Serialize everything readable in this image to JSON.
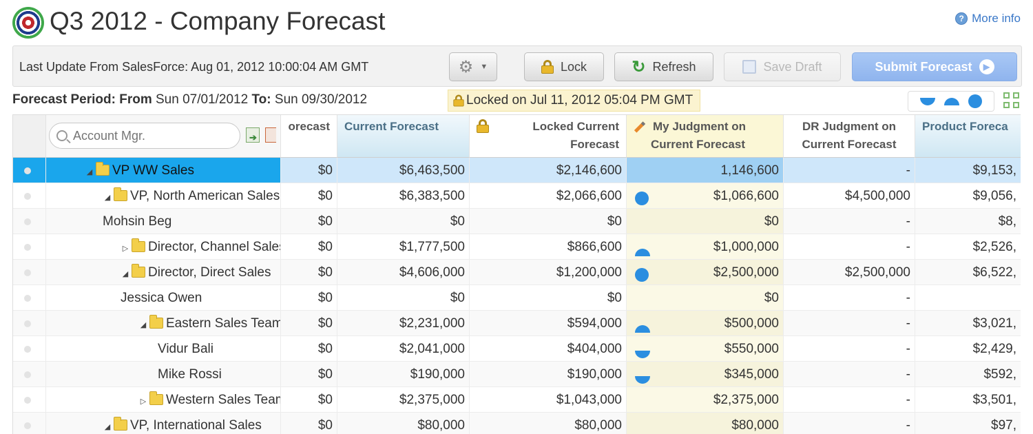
{
  "app": {
    "title": "Q3 2012 - Company Forecast",
    "more_info": "More info"
  },
  "toolbar": {
    "last_update": "Last Update From SalesForce: Aug 01, 2012 10:00:04 AM GMT",
    "lock_label": "Lock",
    "refresh_label": "Refresh",
    "save_draft_label": "Save Draft",
    "submit_label": "Submit Forecast"
  },
  "period": {
    "from_label": "Forecast Period: From",
    "from_value": "Sun 07/01/2012",
    "to_label": "To:",
    "to_value": "Sun 09/30/2012",
    "locked_text": "Locked on Jul 11, 2012 05:04 PM GMT"
  },
  "grid": {
    "search_placeholder": "Account Mgr.",
    "headers": {
      "c1": "orecast",
      "c2": "Current Forecast",
      "c3_line1": "Locked Current",
      "c3_line2": "Forecast",
      "c4_line1": "My Judgment on",
      "c4_line2": "Current Forecast",
      "c5_line1": "DR Judgment on",
      "c5_line2": "Current Forecast",
      "c6": "Product Foreca"
    },
    "rows": [
      {
        "name": "VP WW Sales",
        "c1": "$0",
        "c2": "$6,463,500",
        "c3": "$2,146,600",
        "c4": "1,146,600",
        "c5": "-",
        "c6": "$9,153,"
      },
      {
        "name": "VP, North American Sales",
        "c1": "$0",
        "c2": "$6,383,500",
        "c3": "$2,066,600",
        "c4": "$1,066,600",
        "c5": "$4,500,000",
        "c6": "$9,056,"
      },
      {
        "name": "Mohsin Beg",
        "c1": "$0",
        "c2": "$0",
        "c3": "$0",
        "c4": "$0",
        "c5": "-",
        "c6": "$8,"
      },
      {
        "name": "Director, Channel Sales",
        "c1": "$0",
        "c2": "$1,777,500",
        "c3": "$866,600",
        "c4": "$1,000,000",
        "c5": "-",
        "c6": "$2,526,"
      },
      {
        "name": "Director, Direct Sales",
        "c1": "$0",
        "c2": "$4,606,000",
        "c3": "$1,200,000",
        "c4": "$2,500,000",
        "c5": "$2,500,000",
        "c6": "$6,522,"
      },
      {
        "name": "Jessica Owen",
        "c1": "$0",
        "c2": "$0",
        "c3": "$0",
        "c4": "$0",
        "c5": "-",
        "c6": ""
      },
      {
        "name": "Eastern Sales Team",
        "c1": "$0",
        "c2": "$2,231,000",
        "c3": "$594,000",
        "c4": "$500,000",
        "c5": "-",
        "c6": "$3,021,"
      },
      {
        "name": "Vidur Bali",
        "c1": "$0",
        "c2": "$2,041,000",
        "c3": "$404,000",
        "c4": "$550,000",
        "c5": "-",
        "c6": "$2,429,"
      },
      {
        "name": "Mike Rossi",
        "c1": "$0",
        "c2": "$190,000",
        "c3": "$190,000",
        "c4": "$345,000",
        "c5": "-",
        "c6": "$592,"
      },
      {
        "name": "Western Sales Team",
        "c1": "$0",
        "c2": "$2,375,000",
        "c3": "$1,043,000",
        "c4": "$2,375,000",
        "c5": "-",
        "c6": "$3,501,"
      },
      {
        "name": "VP, International Sales",
        "c1": "$0",
        "c2": "$80,000",
        "c3": "$80,000",
        "c4": "$80,000",
        "c5": "-",
        "c6": "$97,"
      }
    ]
  },
  "icons": {
    "accent_blue": "#2b8ee0",
    "selected_row": "#1aa6ec",
    "submit_button": "#8fb4ee"
  }
}
